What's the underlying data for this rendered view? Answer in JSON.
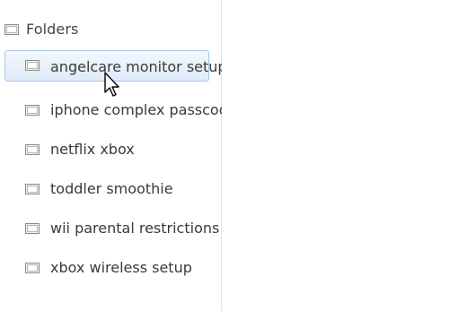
{
  "tree": {
    "root": {
      "label": "Folders",
      "icon": "folder-icon"
    },
    "items": [
      {
        "label": "angelcare monitor setup",
        "icon": "folder-icon",
        "selected": true
      },
      {
        "label": "iphone complex passcode",
        "icon": "folder-icon",
        "selected": false
      },
      {
        "label": "netflix xbox",
        "icon": "folder-icon",
        "selected": false
      },
      {
        "label": "toddler smoothie",
        "icon": "folder-icon",
        "selected": false
      },
      {
        "label": "wii parental restrictions",
        "icon": "folder-icon",
        "selected": false
      },
      {
        "label": "xbox wireless setup",
        "icon": "folder-icon",
        "selected": false
      }
    ]
  },
  "colors": {
    "selection_border": "#a9c6ea",
    "selection_fill": "#e8f0fb",
    "text": "#3a3a3a"
  },
  "cursor": {
    "icon": "arrow-pointer-icon"
  }
}
